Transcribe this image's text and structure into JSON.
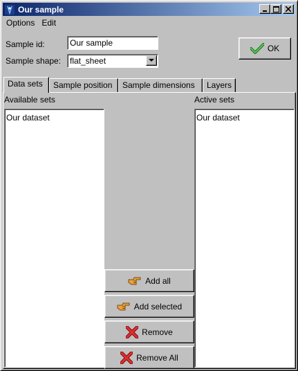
{
  "window": {
    "title": "Our sample",
    "title_buttons": {
      "minimize": "_",
      "maximize": "□",
      "close": "✕"
    }
  },
  "menu": [
    {
      "label": "Options"
    },
    {
      "label": "Edit"
    }
  ],
  "form": {
    "sample_id_label": "Sample id:",
    "sample_id_value": "Our sample",
    "sample_shape_label": "Sample shape:",
    "sample_shape_value": "flat_sheet"
  },
  "ok_button": {
    "label": "OK",
    "icon": "checkmark-icon",
    "icon_color": "#2e8b2e"
  },
  "tabs": [
    {
      "label": "Data sets",
      "active": true
    },
    {
      "label": "Sample position",
      "active": false
    },
    {
      "label": "Sample dimensions",
      "active": false
    },
    {
      "label": "Layers",
      "active": false
    }
  ],
  "data_sets": {
    "available_label": "Available sets",
    "active_label": "Active sets",
    "available_items": [
      "Our dataset"
    ],
    "active_items": [
      "Our dataset"
    ]
  },
  "action_buttons": [
    {
      "label": "Add all",
      "icon": "pointing-hand-icon"
    },
    {
      "label": "Add selected",
      "icon": "pointing-hand-icon"
    },
    {
      "label": "Remove",
      "icon": "red-x-icon"
    },
    {
      "label": "Remove All",
      "icon": "red-x-icon"
    }
  ],
  "colors": {
    "titlebar_start": "#0a246a",
    "titlebar_end": "#a6caf0",
    "face": "#c0c0c0",
    "remove_icon": "#cc1f1f",
    "hand_icon": "#e9a23b"
  }
}
